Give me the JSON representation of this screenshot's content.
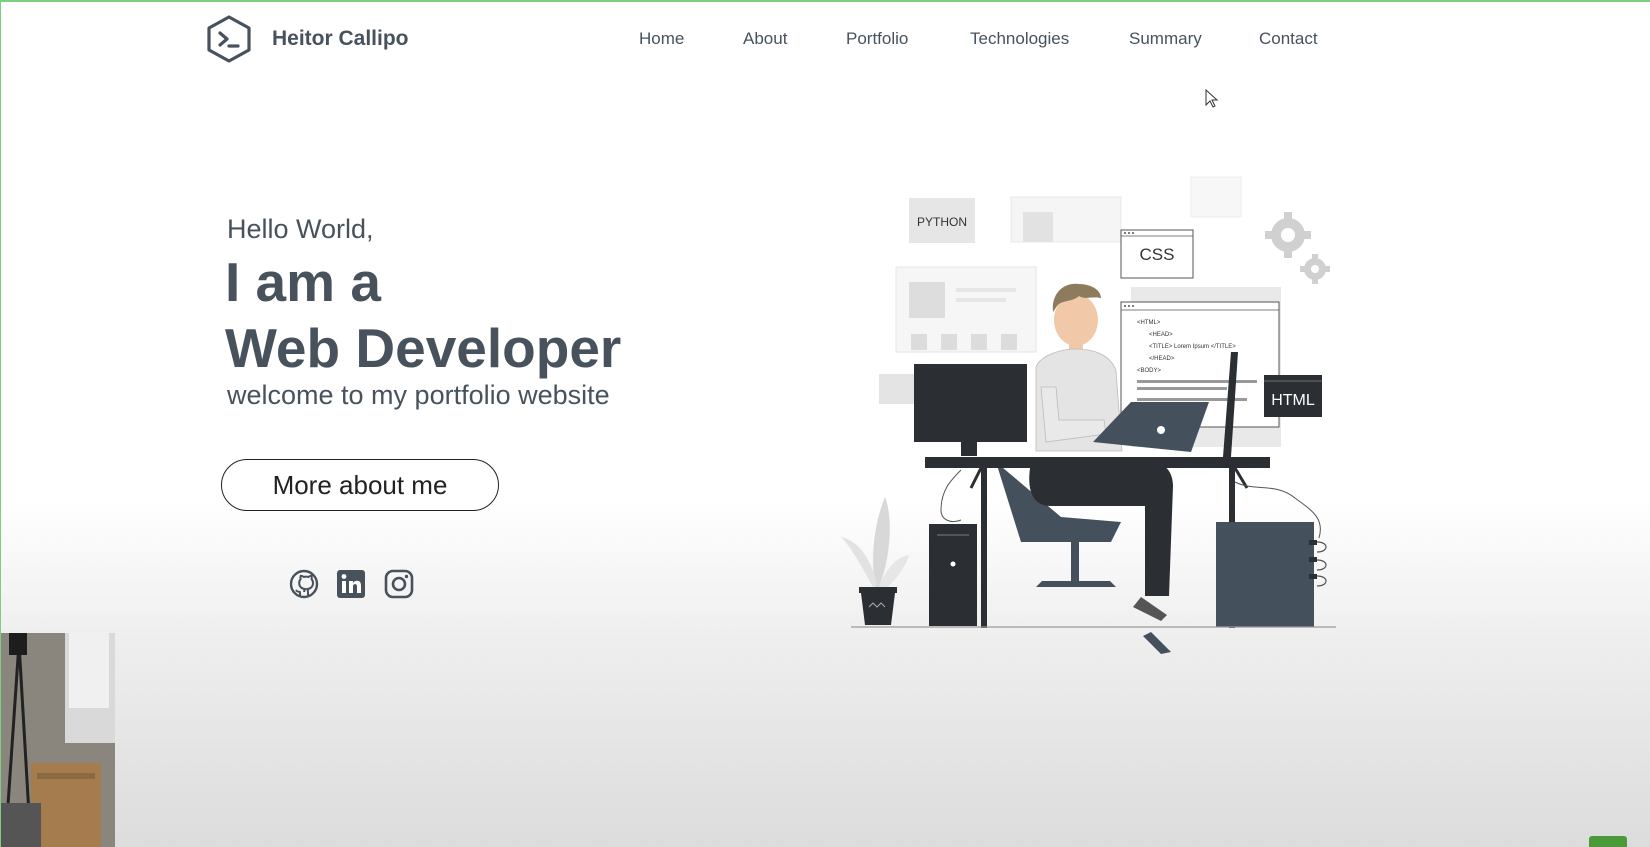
{
  "brand": {
    "name": "Heitor Callipo",
    "logo_icon": "terminal-hexagon-icon"
  },
  "nav": {
    "items": [
      {
        "label": "Home"
      },
      {
        "label": "About"
      },
      {
        "label": "Portfolio"
      },
      {
        "label": "Technologies"
      },
      {
        "label": "Summary"
      },
      {
        "label": "Contact"
      }
    ]
  },
  "hero": {
    "greeting": "Hello World,",
    "title_line1": "I am a",
    "title_line2": "Web Developer",
    "subtitle": "welcome to my portfolio website",
    "cta_label": "More about me"
  },
  "social": [
    {
      "icon": "github-icon"
    },
    {
      "icon": "linkedin-icon"
    },
    {
      "icon": "instagram-icon"
    }
  ],
  "illustration": {
    "python_label": "PYTHON",
    "css_label": "CSS",
    "html_label": "HTML",
    "code_lines": [
      "<HTML>",
      "<HEAD>",
      "<TITLE> Lorem Ipsum </TITLE>",
      "</HEAD>",
      "<BODY>"
    ]
  },
  "colors": {
    "text": "#47525d",
    "accent_border": "#7ccf7c",
    "dark": "#2b2f33"
  }
}
